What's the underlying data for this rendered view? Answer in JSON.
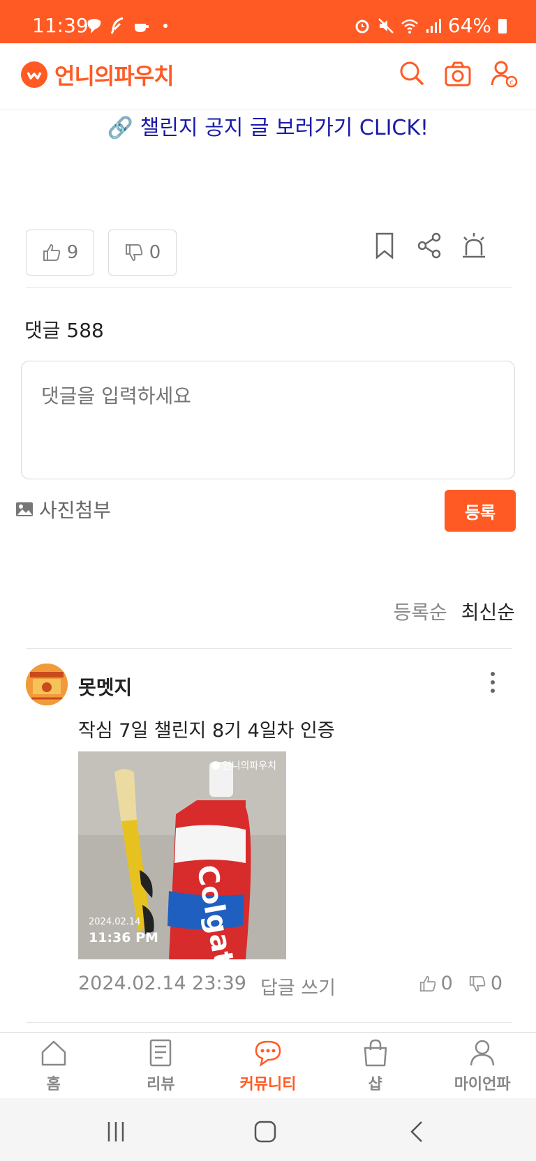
{
  "status_bar": {
    "time": "11:39",
    "battery": "64%",
    "background_color": "#ff5a24"
  },
  "header": {
    "app_name": "언니의파우치",
    "brand_color": "#ff5a24",
    "icons": [
      "search-icon",
      "camera-icon",
      "profile-icon"
    ]
  },
  "notice": {
    "link_text": "🔗 챌린지 공지 글 보러가기 CLICK!"
  },
  "post_actions": {
    "likes": "9",
    "dislikes": "0",
    "icons": [
      "bookmark-icon",
      "share-icon",
      "siren-icon"
    ]
  },
  "comments": {
    "count_label": "댓글 588",
    "input_placeholder": "댓글을 입력하세요",
    "attach_label": "사진첨부",
    "submit_label": "등록",
    "sort_options": [
      "등록순",
      "최신순"
    ],
    "active_sort": "최신순",
    "items": [
      {
        "author": "못멧지",
        "text": "작심 7일 챌린지 8기 4일차 인증",
        "photo": {
          "watermark": "언니의파우치",
          "date": "2024.02.14",
          "time": "11:36 PM"
        },
        "timestamp": "2024.02.14 23:39",
        "reply_label": "답글 쓰기",
        "likes": "0",
        "dislikes": "0"
      }
    ]
  },
  "bottom_nav": {
    "items": [
      {
        "label": "홈",
        "icon": "home-icon"
      },
      {
        "label": "리뷰",
        "icon": "review-icon"
      },
      {
        "label": "커뮤니티",
        "icon": "community-icon"
      },
      {
        "label": "샵",
        "icon": "shop-icon"
      },
      {
        "label": "마이언파",
        "icon": "my-icon"
      }
    ],
    "active": "커뮤니티"
  }
}
